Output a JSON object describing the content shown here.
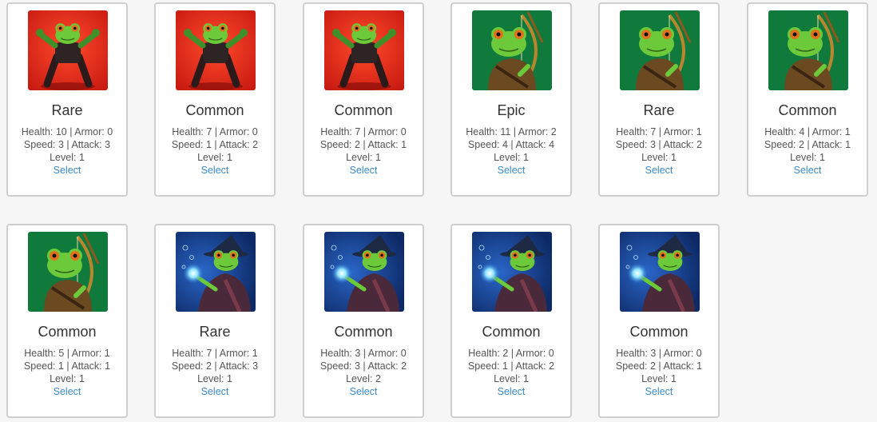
{
  "labels": {
    "health": "Health",
    "armor": "Armor",
    "speed": "Speed",
    "attack": "Attack",
    "level": "Level",
    "select": "Select"
  },
  "colors": {
    "fighter_bg": "#c81a12",
    "archer_bg": "#0f7a3c",
    "wizard_bg": "#0e2a66",
    "select_link": "#3a8ac4"
  },
  "cards": [
    {
      "image": "frog-fighter-portrait",
      "rarity": "Rare",
      "health": 10,
      "armor": 0,
      "speed": 3,
      "attack": 3,
      "level": 1
    },
    {
      "image": "frog-fighter-portrait",
      "rarity": "Common",
      "health": 7,
      "armor": 0,
      "speed": 1,
      "attack": 2,
      "level": 1
    },
    {
      "image": "frog-fighter-portrait",
      "rarity": "Common",
      "health": 7,
      "armor": 0,
      "speed": 2,
      "attack": 1,
      "level": 1
    },
    {
      "image": "frog-archer-portrait",
      "rarity": "Epic",
      "health": 11,
      "armor": 2,
      "speed": 4,
      "attack": 4,
      "level": 1
    },
    {
      "image": "frog-archer-portrait",
      "rarity": "Rare",
      "health": 7,
      "armor": 1,
      "speed": 3,
      "attack": 2,
      "level": 1
    },
    {
      "image": "frog-archer-portrait",
      "rarity": "Common",
      "health": 4,
      "armor": 1,
      "speed": 2,
      "attack": 1,
      "level": 1
    },
    {
      "image": "frog-archer-portrait",
      "rarity": "Common",
      "health": 5,
      "armor": 1,
      "speed": 1,
      "attack": 1,
      "level": 1
    },
    {
      "image": "frog-wizard-portrait",
      "rarity": "Rare",
      "health": 7,
      "armor": 1,
      "speed": 2,
      "attack": 3,
      "level": 1
    },
    {
      "image": "frog-wizard-portrait",
      "rarity": "Common",
      "health": 3,
      "armor": 0,
      "speed": 3,
      "attack": 2,
      "level": 2
    },
    {
      "image": "frog-wizard-portrait",
      "rarity": "Common",
      "health": 2,
      "armor": 0,
      "speed": 1,
      "attack": 2,
      "level": 1
    },
    {
      "image": "frog-wizard-portrait",
      "rarity": "Common",
      "health": 3,
      "armor": 0,
      "speed": 2,
      "attack": 1,
      "level": 1
    }
  ]
}
